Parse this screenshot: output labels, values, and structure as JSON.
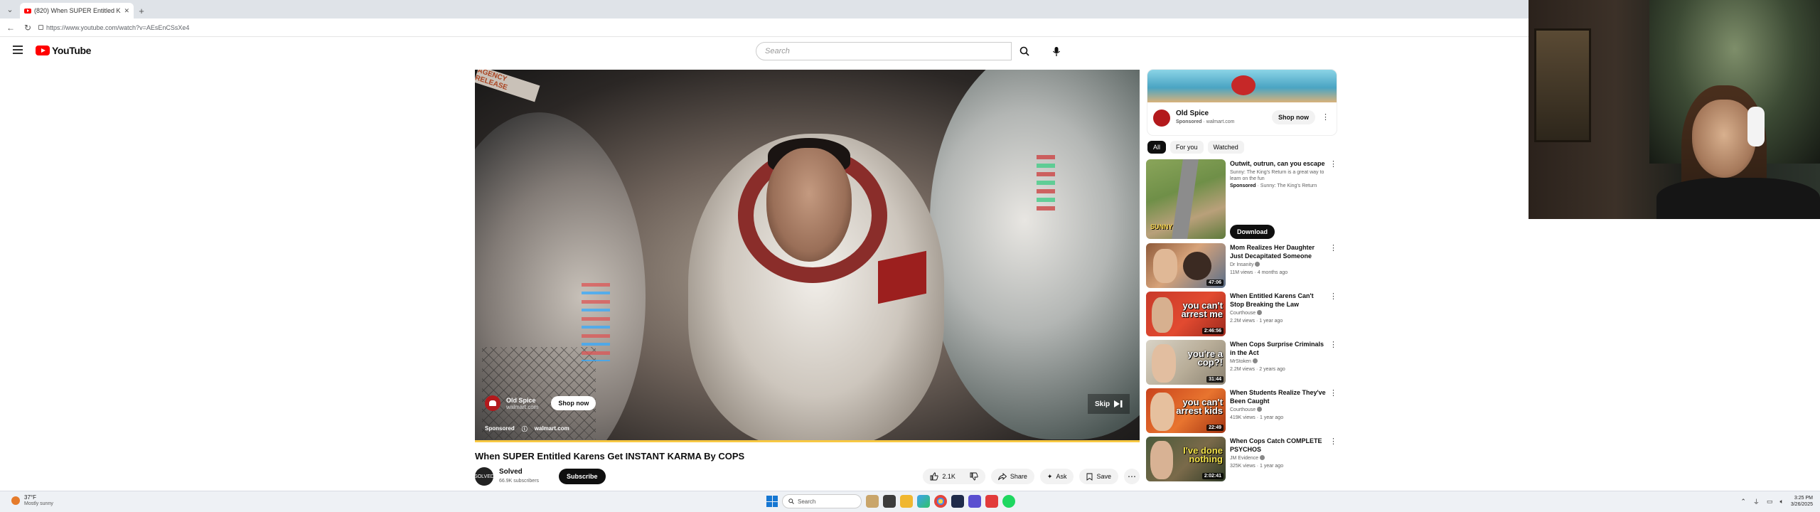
{
  "browser": {
    "tab_title": "(820) When SUPER Entitled K",
    "url": "https://www.youtube.com/watch?v=AEsEnCSsXe4"
  },
  "header": {
    "logo_text": "YouTube",
    "search_placeholder": "Search"
  },
  "player": {
    "scene_sign": "AGENCY RELEASE",
    "ad": {
      "advertiser": "Old Spice",
      "domain": "walmart.com",
      "shop_label": "Shop now",
      "sponsored_label": "Sponsored",
      "footer_domain": "walmart.com"
    },
    "skip_label": "Skip",
    "progress": 1.0,
    "progress_color": "#f7c843"
  },
  "video": {
    "title": "When SUPER Entitled Karens Get INSTANT KARMA By COPS",
    "channel_name": "Solved",
    "channel_avatar_text": "SOLVED",
    "subscribers": "66.9K subscribers",
    "subscribe_label": "Subscribe",
    "likes": "2.1K",
    "share_label": "Share",
    "ask_label": "Ask",
    "save_label": "Save"
  },
  "sidebar": {
    "ad": {
      "name": "Old Spice",
      "sponsored": "Sponsored",
      "domain": "walmart.com",
      "shop_label": "Shop now"
    },
    "chips": [
      "All",
      "For you",
      "Watched"
    ],
    "promo": {
      "title": "Outwit, outrun, can you escape",
      "description": "Sunny: The King's Return is a great way to learn on the fun",
      "sponsored": "Sponsored",
      "sponsor_name": "Sunny: The King's Return",
      "download_label": "Download",
      "thumb_text": "SUNNY"
    },
    "items": [
      {
        "title": "Mom Realizes Her Daughter Just Decapitated Someone",
        "channel": "Dr Insanity",
        "meta": "11M views · 4 months ago",
        "duration": "47:06",
        "thumb_text": ""
      },
      {
        "title": "When Entitled Karens Can't Stop Breaking the Law",
        "channel": "Courthouse",
        "meta": "2.2M views · 1 year ago",
        "duration": "2:46:56",
        "thumb_text": "you can't arrest me"
      },
      {
        "title": "When Cops Surprise Criminals in the Act",
        "channel": "MrStoken",
        "meta": "2.2M views · 2 years ago",
        "duration": "31:44",
        "thumb_text": "you're a cop?!"
      },
      {
        "title": "When Students Realize They've Been Caught",
        "channel": "Courthouse",
        "meta": "419K views · 1 year ago",
        "duration": "22:49",
        "thumb_text": "you can't arrest kids"
      },
      {
        "title": "When Cops Catch COMPLETE PSYCHOS",
        "channel": "JM Evidence",
        "meta": "325K views · 1 year ago",
        "duration": "2:02:41",
        "thumb_text": "I've done nothing"
      }
    ]
  },
  "taskbar": {
    "weather_temp": "37°F",
    "weather_desc": "Mostly sunny",
    "search_label": "Search",
    "time": "3:25 PM",
    "date": "3/26/2025"
  },
  "icons": {
    "menu": "hamburger-icon",
    "search": "search-icon",
    "mic": "mic-icon",
    "like": "thumbs-up-icon",
    "dislike": "thumbs-down-icon",
    "share": "share-icon",
    "ask": "sparkle-icon",
    "save": "bookmark-icon",
    "more": "more-horizontal-icon"
  },
  "colors": {
    "youtube_red": "#ff0000",
    "text_primary": "#0f0f0f",
    "text_secondary": "#606060"
  }
}
